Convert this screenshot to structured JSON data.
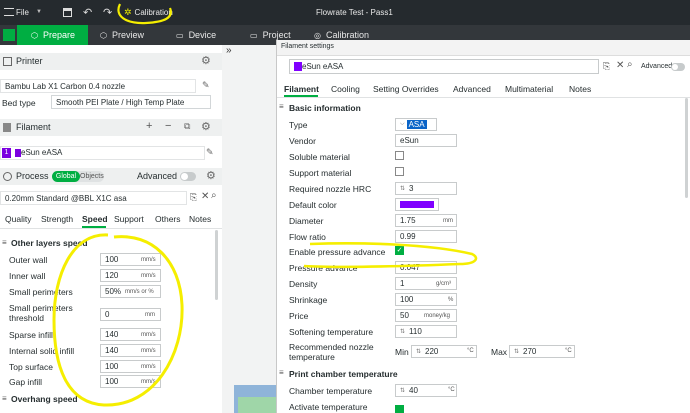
{
  "titlebar": {
    "file_menu": "File",
    "calibration": "Calibration",
    "window_title": "Flowrate Test - Pass1"
  },
  "tabs": {
    "prepare": "Prepare",
    "preview": "Preview",
    "device": "Device",
    "project": "Project",
    "calibration": "Calibration"
  },
  "printer": {
    "section_title": "Printer",
    "selected": "Bambu Lab X1 Carbon 0.4 nozzle",
    "bed_type_label": "Bed type",
    "bed_type_value": "Smooth PEI Plate / High Temp Plate"
  },
  "filament": {
    "section_title": "Filament",
    "slot_number": "1",
    "slot_name": "eSun eASA",
    "slot_color": "#7b00e0"
  },
  "process": {
    "section_title": "Process",
    "mode_global": "Global",
    "mode_objects": "Objects",
    "advanced_label": "Advanced",
    "preset": "0.20mm Standard @BBL X1C asa",
    "subtabs": [
      "Quality",
      "Strength",
      "Speed",
      "Support",
      "Others",
      "Notes"
    ],
    "group_other_layers": "Other layers speed",
    "speed_rows": [
      {
        "label": "Outer wall",
        "value": "100",
        "unit": "mm/s"
      },
      {
        "label": "Inner wall",
        "value": "120",
        "unit": "mm/s"
      },
      {
        "label": "Small perimeters",
        "value": "50%",
        "unit": "mm/s or %"
      },
      {
        "label": "Small perimeters threshold",
        "value": "0",
        "unit": "mm"
      },
      {
        "label": "Sparse infill",
        "value": "140",
        "unit": "mm/s"
      },
      {
        "label": "Internal solid infill",
        "value": "140",
        "unit": "mm/s"
      },
      {
        "label": "Top surface",
        "value": "100",
        "unit": "mm/s"
      },
      {
        "label": "Gap infill",
        "value": "100",
        "unit": "mm/s"
      }
    ],
    "group_overhang": "Overhang speed"
  },
  "dialog": {
    "title": "Filament settings",
    "preset_name": "eSun eASA",
    "advanced_label": "Advanced",
    "tabs": [
      "Filament",
      "Cooling",
      "Setting Overrides",
      "Advanced",
      "Multimaterial",
      "Notes"
    ],
    "basic_section": "Basic information",
    "type_label": "Type",
    "type_value": "ASA",
    "vendor_label": "Vendor",
    "vendor_value": "eSun",
    "soluble_label": "Soluble material",
    "support_label": "Support material",
    "nozzle_hrc_label": "Required nozzle HRC",
    "nozzle_hrc_value": "3",
    "default_color_label": "Default color",
    "default_color": "#8000ff",
    "diameter_label": "Diameter",
    "diameter_value": "1.75",
    "diameter_unit": "mm",
    "flow_ratio_label": "Flow ratio",
    "flow_ratio_value": "0.99",
    "enable_pa_label": "Enable pressure advance",
    "pa_label": "Pressure advance",
    "pa_value": "0.047",
    "density_label": "Density",
    "density_value": "1",
    "density_unit": "g/cm³",
    "shrinkage_label": "Shrinkage",
    "shrinkage_value": "100",
    "shrinkage_unit": "%",
    "price_label": "Price",
    "price_value": "50",
    "price_unit": "money/kg",
    "softening_label": "Softening temperature",
    "softening_value": "110",
    "rec_nozzle_label": "Recommended nozzle temperature",
    "min_label": "Min",
    "min_value": "220",
    "max_label": "Max",
    "max_value": "270",
    "temp_unit": "°C",
    "chamber_section": "Print chamber temperature",
    "chamber_label": "Chamber temperature",
    "chamber_value": "40",
    "activate_label": "Activate temperature"
  },
  "colors": {
    "accent": "#00ae42",
    "highlight": "#f5ee00",
    "titlebar": "#252a2e",
    "tabbar": "#33373b"
  }
}
